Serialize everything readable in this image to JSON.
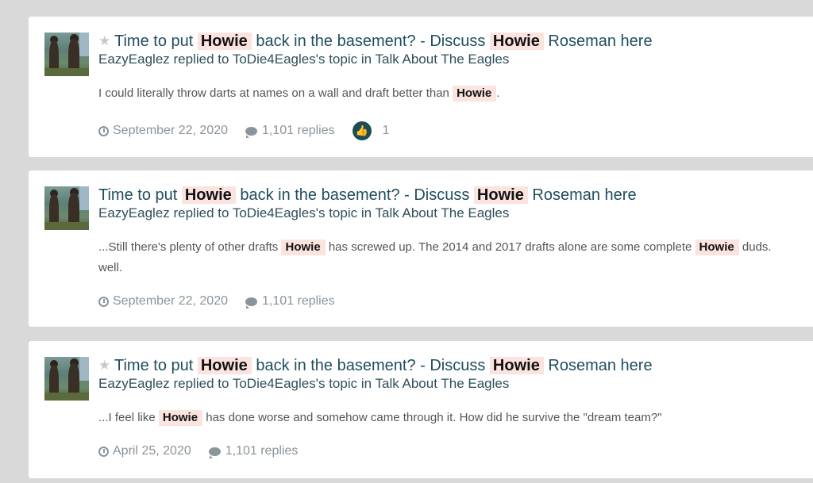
{
  "results": [
    {
      "starred": true,
      "title_prefix": "Time to put",
      "title_hl1": "Howie",
      "title_mid": "back in the basement? - Discuss",
      "title_hl2": "Howie",
      "title_suffix": "Roseman here",
      "meta": "EazyEaglez replied to ToDie4Eagles's topic in Talk About The Eagles",
      "snippet_a": "I could literally throw darts at names on a wall and draft better than",
      "snippet_hl": "Howie",
      "snippet_b": ".",
      "date": "September 22, 2020",
      "replies": "1,101 replies",
      "reactions": "1"
    },
    {
      "starred": false,
      "title_prefix": "Time to put",
      "title_hl1": "Howie",
      "title_mid": "back in the basement? - Discuss",
      "title_hl2": "Howie",
      "title_suffix": "Roseman here",
      "meta": "EazyEaglez replied to ToDie4Eagles's topic in Talk About The Eagles",
      "snippet_a": "...Still there's plenty of other drafts",
      "snippet_hl": "Howie",
      "snippet_b": "has screwed up. The 2014 and 2017 drafts alone are some complete",
      "snippet_hl2": "Howie",
      "snippet_c": "duds.",
      "snippet_d": "well.",
      "date": "September 22, 2020",
      "replies": "1,101 replies"
    },
    {
      "starred": true,
      "title_prefix": "Time to put",
      "title_hl1": "Howie",
      "title_mid": "back in the basement? - Discuss",
      "title_hl2": "Howie",
      "title_suffix": "Roseman here",
      "meta": "EazyEaglez replied to ToDie4Eagles's topic in Talk About The Eagles",
      "snippet_a": "...I feel like",
      "snippet_hl": "Howie",
      "snippet_b": "has done worse and somehow came through it. How did he survive the \"dream team?\"",
      "date": "April 25, 2020",
      "replies": "1,101 replies"
    }
  ],
  "icons": {
    "star": "star-icon",
    "clock": "clock-icon",
    "comment": "comment-icon",
    "like": "thumbs-up-icon"
  },
  "colors": {
    "title": "#1f4e5f",
    "highlight_bg": "#fbe3df",
    "meta_gray": "#8a949b",
    "like_badge": "#1d4b57",
    "page_bg": "#d9d9d9"
  }
}
